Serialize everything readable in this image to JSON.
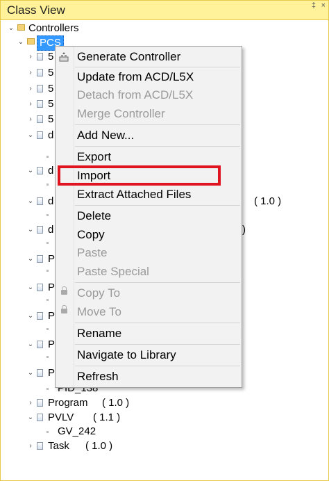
{
  "panel": {
    "title": "Class View",
    "pin_glyph": "‡",
    "close_glyph": "×"
  },
  "tree": {
    "root": "Controllers",
    "selected": "PCS",
    "partial_rows": [
      "5",
      "5",
      "5",
      "5",
      "5"
    ],
    "folded_rows": [
      "d",
      "d",
      "d",
      "d"
    ],
    "program_partials": [
      "P",
      "P",
      "P",
      "P",
      "P"
    ],
    "versions": [
      "( 1.0 )",
      ")"
    ],
    "pid": "PID_138",
    "program": "Program",
    "program_version": "( 1.0 )",
    "pvlv": "PVLV",
    "pvlv_version": "( 1.1 )",
    "gv": "GV_242",
    "task": "Task",
    "task_version": "( 1.0 )"
  },
  "context_menu": {
    "items": [
      {
        "label": "Generate Controller",
        "enabled": true,
        "icon": "generate-icon"
      },
      {
        "label": "Update from ACD/L5X",
        "enabled": true
      },
      {
        "label": "Detach from ACD/L5X",
        "enabled": false
      },
      {
        "label": "Merge Controller",
        "enabled": false
      },
      {
        "label": "Add New...",
        "enabled": true
      },
      {
        "label": "Export",
        "enabled": true
      },
      {
        "label": "Import",
        "enabled": true
      },
      {
        "label": "Extract Attached Files",
        "enabled": true
      },
      {
        "label": "Delete",
        "enabled": true
      },
      {
        "label": "Copy",
        "enabled": true
      },
      {
        "label": "Paste",
        "enabled": false
      },
      {
        "label": "Paste Special",
        "enabled": false
      },
      {
        "label": "Copy To",
        "enabled": false,
        "icon": "lock-icon"
      },
      {
        "label": "Move To",
        "enabled": false,
        "icon": "lock-icon"
      },
      {
        "label": "Rename",
        "enabled": true
      },
      {
        "label": "Navigate to Library",
        "enabled": true
      },
      {
        "label": "Refresh",
        "enabled": true
      }
    ]
  },
  "colors": {
    "title_bar": "#fff29a",
    "selection": "#3399ff",
    "highlight_box": "#e0141e"
  }
}
